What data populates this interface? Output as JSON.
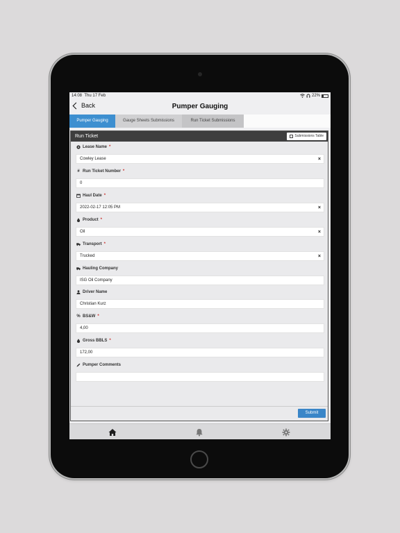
{
  "status": {
    "time": "14:08",
    "date": "Thu 17 Feb",
    "battery": "22%"
  },
  "nav": {
    "back_label": "Back",
    "title": "Pumper Gauging"
  },
  "tabs": [
    {
      "label": "Pumper Gauging",
      "active": true
    },
    {
      "label": "Gauge Sheets Submissions"
    },
    {
      "label": "Run Ticket Submissions"
    }
  ],
  "panel": {
    "title": "Run Ticket",
    "submissions_button": "Submissions Table"
  },
  "fields": [
    {
      "label": "Lease Name",
      "required": "*",
      "value": "Cowley Lease",
      "icon": "circle-icon"
    },
    {
      "label": "Run Ticket Number",
      "required": "*",
      "value": "0",
      "icon": "hashtag-icon"
    },
    {
      "label": "Haul Date",
      "required": "*",
      "value": "2022-02-17 12:05 PM",
      "icon": "calendar-icon"
    },
    {
      "label": "Product",
      "required": "*",
      "value": "Oil",
      "icon": "droplet-icon"
    },
    {
      "label": "Transport",
      "required": "*",
      "value": "Trucked",
      "icon": "truck-icon"
    },
    {
      "label": "Hauling Company",
      "value": "ISG Oil Company",
      "icon": "truck-icon"
    },
    {
      "label": "Driver Name",
      "value": "Christian Kurz",
      "icon": "user-icon"
    },
    {
      "label": "BS&W",
      "required": "*",
      "value": "4,00",
      "icon": "percent-icon"
    },
    {
      "label": "Gross BBLS",
      "required": "*",
      "value": "172,00",
      "icon": "droplet-icon"
    },
    {
      "label": "Pumper Comments",
      "value": "",
      "icon": "pencil-icon"
    }
  ],
  "clear_symbol": "×",
  "footer": {
    "submit_label": "Submit"
  },
  "icons": {
    "home": "home-icon",
    "notifications": "bell-icon",
    "settings": "gear-icon"
  },
  "colors": {
    "accent": "#3d8fd0",
    "required": "#c9302c",
    "header": "#3e3e3e"
  }
}
